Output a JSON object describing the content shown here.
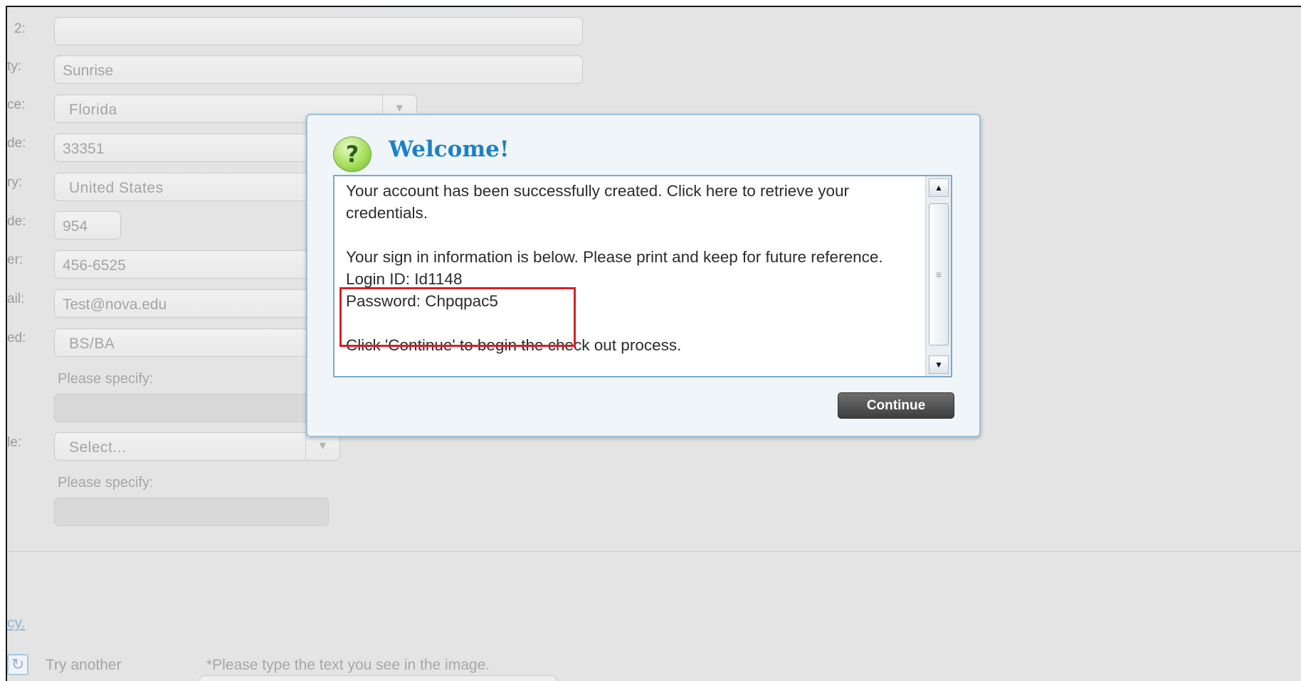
{
  "form": {
    "label_fragments": [
      "2:",
      "ty:",
      "ce:",
      "de:",
      "ry:",
      "de:",
      "er:",
      "ail:",
      "ed:",
      "le:"
    ],
    "address2_value": "",
    "city_value": "Sunrise",
    "state_value": "Florida",
    "zip_value": "33351",
    "country_value": "United States",
    "area_code_value": "954",
    "phone_value": "456-6525",
    "email_value": "Test@nova.edu",
    "education_value": "BS/BA",
    "specify_label_1": "Please specify:",
    "role_value": "Select...",
    "specify_label_2": "Please specify:"
  },
  "footer": {
    "link_fragment": "cy.",
    "try_another": "Try another",
    "captcha_hint": "*Please type the text you see in the image."
  },
  "modal": {
    "title": "Welcome!",
    "icon_glyph": "?",
    "message_line_1": "Your account has been successfully created. Click here to retrieve your credentials.",
    "message_line_2": "Your sign in information is below. Please print and keep for future reference.",
    "login_id": "Login ID: Id1148",
    "password": "Password: Chpqpac5",
    "message_line_3": "Click 'Continue' to begin the check out process.",
    "continue_label": "Continue"
  },
  "colors": {
    "title_blue": "#1d80c6",
    "highlight_red": "#d42027",
    "button_dark": "#4a4a4a"
  }
}
